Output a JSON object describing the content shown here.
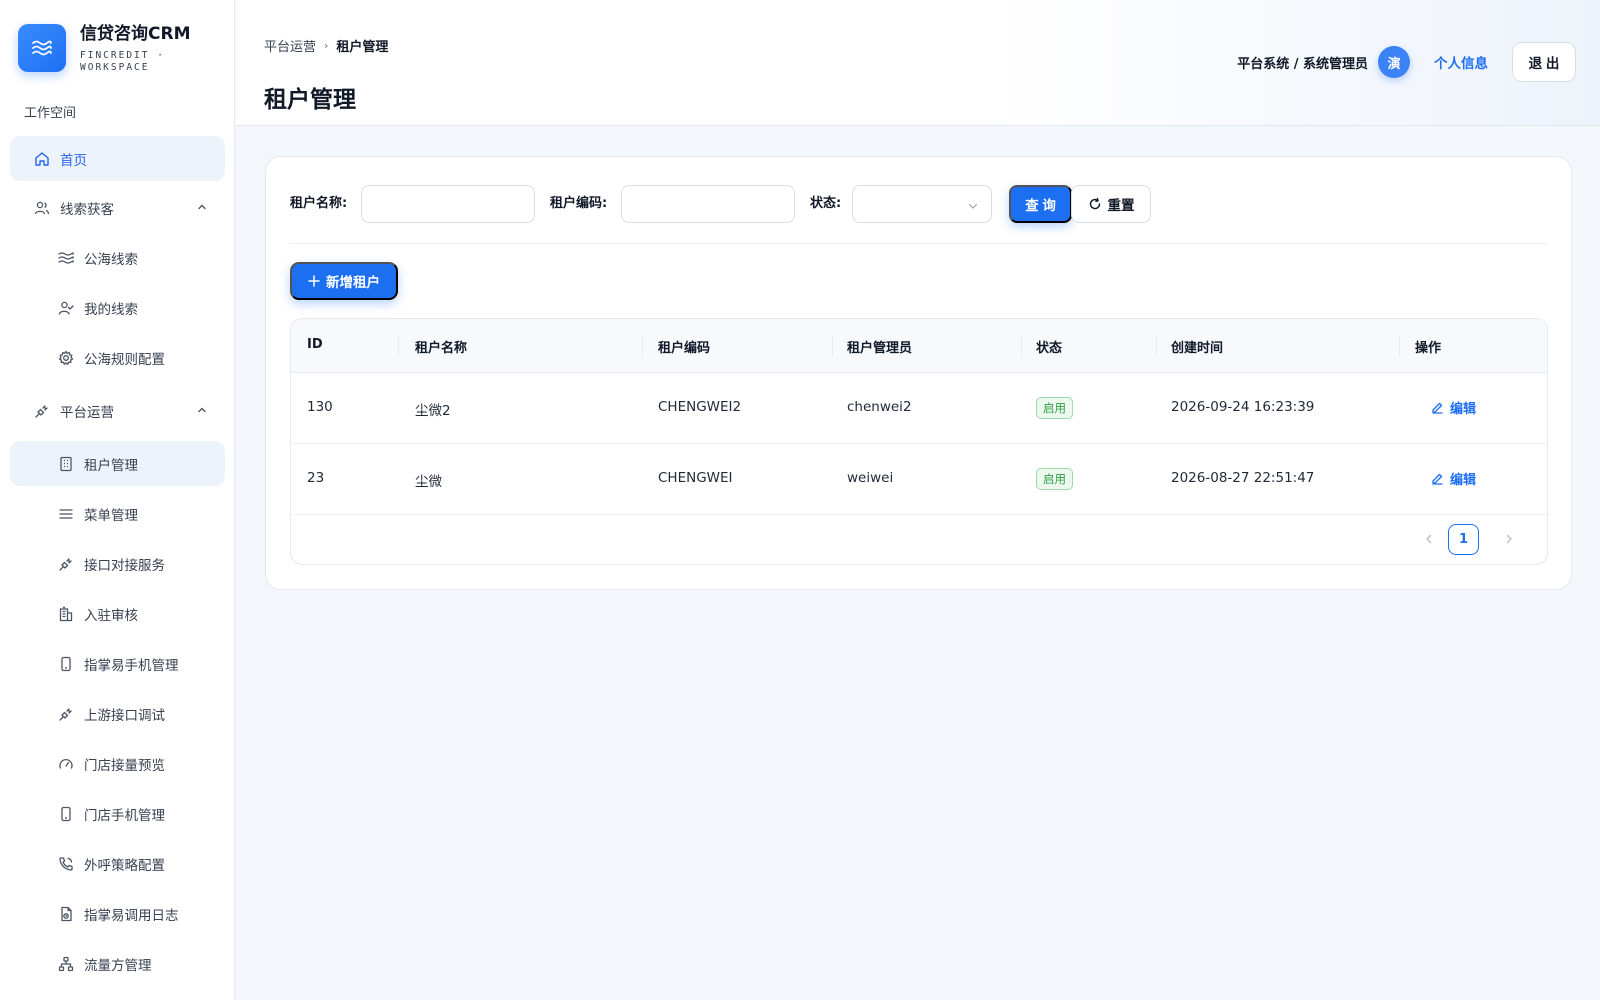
{
  "brand": {
    "title": "信贷咨询CRM",
    "subtitle": "FINCREDIT · WORKSPACE",
    "logo_icon": "waves-icon"
  },
  "sidebar": {
    "workspace_label": "工作空间",
    "items": [
      {
        "label": "首页",
        "icon": "home-icon",
        "level": "top",
        "active": true
      },
      {
        "label": "线索获客",
        "icon": "users-icon",
        "level": "top",
        "expanded": true
      },
      {
        "label": "公海线索",
        "icon": "waves-icon",
        "level": "sub"
      },
      {
        "label": "我的线索",
        "icon": "user-check-icon",
        "level": "sub"
      },
      {
        "label": "公海规则配置",
        "icon": "gear-icon",
        "level": "sub"
      },
      {
        "label": "平台运营",
        "icon": "plug-icon",
        "level": "top",
        "expanded": true
      },
      {
        "label": "租户管理",
        "icon": "building-icon",
        "level": "sub",
        "active": true
      },
      {
        "label": "菜单管理",
        "icon": "menu-icon",
        "level": "sub"
      },
      {
        "label": "接口对接服务",
        "icon": "plug-icon",
        "level": "sub"
      },
      {
        "label": "入驻审核",
        "icon": "office-icon",
        "level": "sub"
      },
      {
        "label": "指掌易手机管理",
        "icon": "phone-icon",
        "level": "sub"
      },
      {
        "label": "上游接口调试",
        "icon": "plug-icon",
        "level": "sub"
      },
      {
        "label": "门店接量预览",
        "icon": "gauge-icon",
        "level": "sub"
      },
      {
        "label": "门店手机管理",
        "icon": "phone-icon",
        "level": "sub"
      },
      {
        "label": "外呼策略配置",
        "icon": "phone-call-icon",
        "level": "sub"
      },
      {
        "label": "指掌易调用日志",
        "icon": "file-log-icon",
        "level": "sub"
      },
      {
        "label": "流量方管理",
        "icon": "network-icon",
        "level": "sub"
      }
    ]
  },
  "header": {
    "breadcrumb": [
      "平台运营",
      "租户管理"
    ],
    "breadcrumb_sep": "›",
    "title": "租户管理",
    "user_role": "平台系统 / 系统管理员",
    "avatar_char": "演",
    "profile_link": "个人信息",
    "logout": "退 出"
  },
  "filters": {
    "tenant_name_label": "租户名称:",
    "tenant_name_value": "",
    "tenant_code_label": "租户编码:",
    "tenant_code_value": "",
    "status_label": "状态:",
    "status_value": "",
    "query_button": "查 询",
    "reset_button": "重置"
  },
  "toolbar": {
    "add_button": "新增租户"
  },
  "table": {
    "columns": [
      "ID",
      "租户名称",
      "租户编码",
      "租户管理员",
      "状态",
      "创建时间",
      "操作"
    ],
    "rows": [
      {
        "id": "130",
        "name": "尘微2",
        "code": "CHENGWEI2",
        "admin": "chenwei2",
        "status": "启用",
        "created": "2026-09-24 16:23:39",
        "action": "编辑"
      },
      {
        "id": "23",
        "name": "尘微",
        "code": "CHENGWEI",
        "admin": "weiwei",
        "status": "启用",
        "created": "2026-08-27 22:51:47",
        "action": "编辑"
      }
    ]
  },
  "pagination": {
    "current_page": "1"
  },
  "colors": {
    "primary": "#1d6ff2",
    "success": "#2f9e44",
    "active_bg": "#edf3fb"
  }
}
